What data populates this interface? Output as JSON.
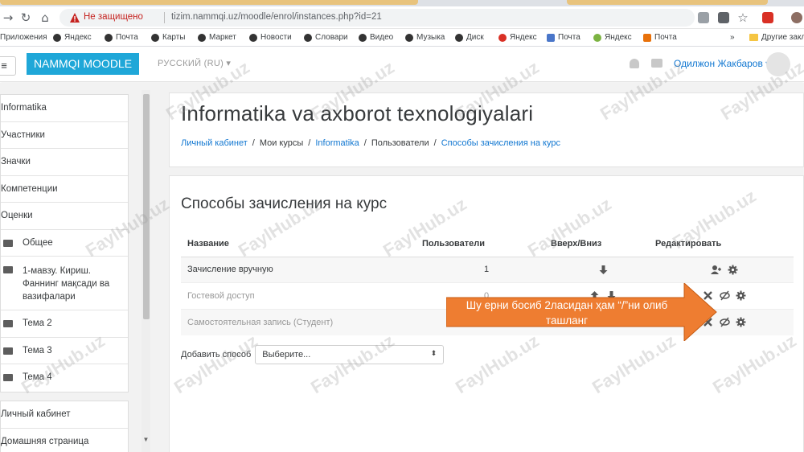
{
  "browser": {
    "security_label": "Не защищено",
    "url": "tizim.nammqi.uz/moodle/enrol/instances.php?id=21",
    "bookmarks": [
      "Приложения",
      "Яндекс",
      "Почта",
      "Карты",
      "Маркет",
      "Новости",
      "Словари",
      "Видео",
      "Музыка",
      "Диск",
      "Яндекс",
      "Почта",
      "Яндекс",
      "Почта"
    ],
    "overflow": "»",
    "other_bookmarks": "Другие закл"
  },
  "navbar": {
    "brand": "NAMMQI MOODLE",
    "language": "РУССКИЙ (RU) ▾",
    "user_name": "Одилжон Жакбаров ▾"
  },
  "sidebar": {
    "items": [
      "Informatika",
      "Участники",
      "Значки",
      "Компетенции",
      "Оценки"
    ],
    "sections": [
      "Общее",
      "1-мавзу. Кириш. Фаннинг мақсади ва вазифалари",
      "Тема 2",
      "Тема 3",
      "Тема 4"
    ],
    "bottom": [
      "Личный кабинет",
      "Домашняя страница"
    ]
  },
  "page": {
    "title": "Informatika va axborot texnologiyalari",
    "breadcrumb": [
      "Личный кабинет",
      "Мои курсы",
      "Informatika",
      "Пользователи",
      "Способы зачисления на курс"
    ],
    "separator": "/"
  },
  "enrol": {
    "heading": "Способы зачисления на курс",
    "columns": [
      "Название",
      "Пользователи",
      "Вверх/Вниз",
      "Редактировать"
    ],
    "rows": [
      {
        "name": "Зачисление вручную",
        "users": "1"
      },
      {
        "name": "Гостевой доступ",
        "users": "0"
      },
      {
        "name": "Самостоятельная запись (Студент)",
        "users": "0"
      }
    ],
    "add_label": "Добавить способ",
    "add_select": "Выберите..."
  },
  "annotation": {
    "text": "Шу ерни босиб  2ласидан ҳам “/”ни олиб ташланг"
  },
  "watermark": "FaylHub.uz",
  "colors": {
    "brand": "#1fa7d8",
    "link": "#1177d1",
    "annotation": "#ee7d31"
  }
}
